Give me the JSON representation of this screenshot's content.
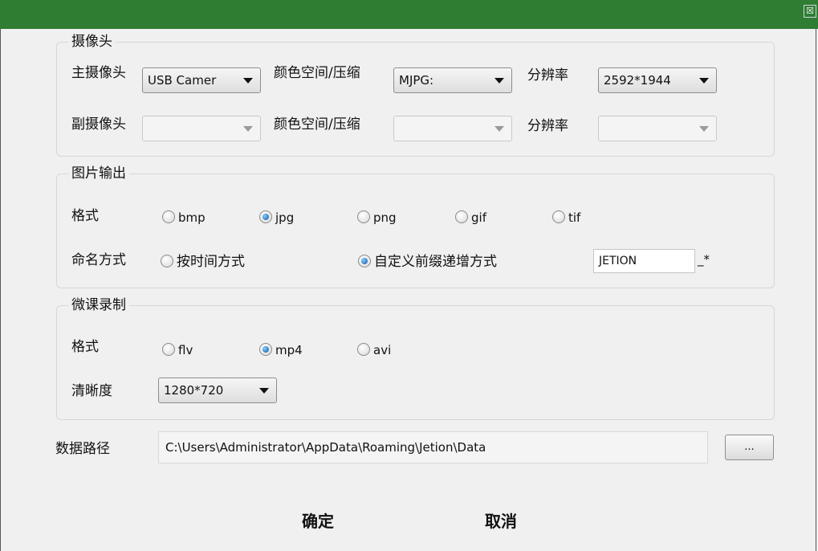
{
  "window": {
    "close_glyph": "☒"
  },
  "camera": {
    "legend": "摄像头",
    "main_label": "主摄像头",
    "main_device": "USB Camer",
    "color_label": "颜色空间/压缩",
    "main_color": "MJPG:",
    "res_label": "分辨率",
    "main_res": "2592*1944",
    "sub_label": "副摄像头",
    "sub_device": "",
    "sub_color": "",
    "sub_res": ""
  },
  "image_output": {
    "legend": "图片输出",
    "format_label": "格式",
    "formats": [
      "bmp",
      "jpg",
      "png",
      "gif",
      "tif"
    ],
    "selected_format": "jpg",
    "naming_label": "命名方式",
    "naming_time": "按时间方式",
    "naming_custom": "自定义前缀递增方式",
    "selected_naming": "custom",
    "prefix_value": "JETION",
    "prefix_suffix": "_*"
  },
  "micro_lesson": {
    "legend": "微课录制",
    "format_label": "格式",
    "formats": [
      "flv",
      "mp4",
      "avi"
    ],
    "selected_format": "mp4",
    "clarity_label": "清晰度",
    "clarity_value": "1280*720"
  },
  "data_path": {
    "label": "数据路径",
    "value": "C:\\Users\\Administrator\\AppData\\Roaming\\Jetion\\Data",
    "browse_label": "..."
  },
  "actions": {
    "ok_label": "确定",
    "cancel_label": "取消"
  },
  "colors": {
    "titlebar": "#2e7d32",
    "radio_selected": "#1a4f9c"
  },
  "icons": {
    "close": "close-icon",
    "dropdown": "chevron-down-icon"
  }
}
